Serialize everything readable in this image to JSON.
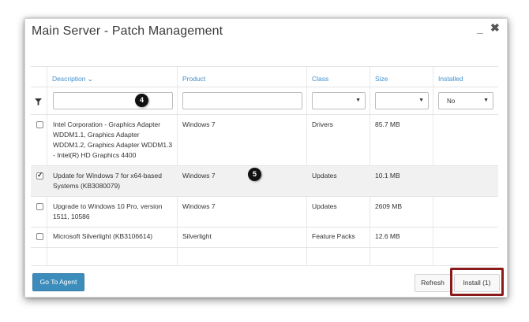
{
  "dialog": {
    "title": "Main Server - Patch Management",
    "minimize_glyph": "_",
    "close_glyph": "✖"
  },
  "columns": {
    "description": "Description",
    "product": "Product",
    "class": "Class",
    "size": "Size",
    "installed": "Installed"
  },
  "filters": {
    "description_value": "",
    "product_value": "",
    "class_value": "",
    "size_value": "",
    "installed_value": "No"
  },
  "rows": [
    {
      "description": [
        "Intel Corporation - Graphics Adapter",
        "WDDM1.1, Graphics Adapter",
        "WDDM1.2, Graphics Adapter WDDM1.3",
        "- Intel(R) HD Graphics 4400"
      ],
      "product": "Windows 7",
      "class": "Drivers",
      "size": "85.7 MB",
      "checked": false
    },
    {
      "description": [
        "Update for Windows 7 for x64-based",
        "Systems (KB3080079)"
      ],
      "product": "Windows 7",
      "class": "Updates",
      "size": "10.1 MB",
      "checked": true
    },
    {
      "description": [
        "Upgrade to Windows 10 Pro, version",
        "1511, 10586"
      ],
      "product": "Windows 7",
      "class": "Updates",
      "size": "2609 MB",
      "checked": false
    },
    {
      "description": [
        "Microsoft Silverlight (KB3106614)"
      ],
      "product": "Silverlight",
      "class": "Feature Packs",
      "size": "12.6 MB",
      "checked": false
    }
  ],
  "callouts": [
    "4",
    "5"
  ],
  "footer": {
    "go_to_agent": "Go To Agent",
    "refresh": "Refresh",
    "install": "Install (1)"
  },
  "colors": {
    "accent": "#3c8dbc",
    "link": "#3f8fce",
    "highlight_border": "#8b1b1b"
  }
}
